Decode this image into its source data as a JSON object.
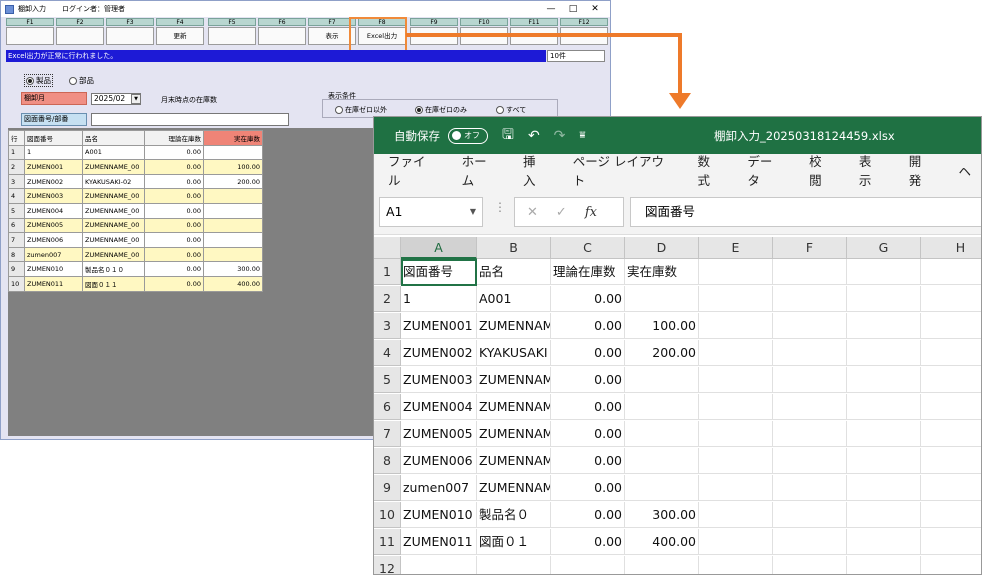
{
  "app": {
    "title": "棚卸入力",
    "login": "ログイン者：管理者",
    "window_controls": [
      "—",
      "□",
      "✕"
    ],
    "fkeys": [
      {
        "key": "F1",
        "label": ""
      },
      {
        "key": "F2",
        "label": ""
      },
      {
        "key": "F3",
        "label": ""
      },
      {
        "key": "F4",
        "label": "更新"
      },
      {
        "key": "F5",
        "label": ""
      },
      {
        "key": "F6",
        "label": ""
      },
      {
        "key": "F7",
        "label": "表示"
      },
      {
        "key": "F8",
        "label": "Excel出力"
      },
      {
        "key": "F9",
        "label": ""
      },
      {
        "key": "F10",
        "label": ""
      },
      {
        "key": "F11",
        "label": ""
      },
      {
        "key": "F12",
        "label": ""
      }
    ],
    "status_message": "Excel出力が正常に行われました。",
    "record_count": "10件",
    "type_options": [
      {
        "label": "製品",
        "selected": true
      },
      {
        "label": "部品",
        "selected": false
      }
    ],
    "tanaorosi_label": "棚卸月",
    "month_value": "2025/02",
    "month_note": "月末時点の在庫数",
    "zumen_label": "図面番号/部番",
    "zumen_value": "",
    "display_condition": {
      "title": "表示条件",
      "options": [
        {
          "label": "在庫ゼロ以外",
          "selected": false
        },
        {
          "label": "在庫ゼロのみ",
          "selected": true
        },
        {
          "label": "すべて",
          "selected": false
        }
      ]
    },
    "grid": {
      "headers": [
        "行",
        "図面番号",
        "品名",
        "理論在庫数",
        "実在庫数"
      ],
      "rows": [
        [
          "1",
          "1",
          "A001",
          "0.00",
          ""
        ],
        [
          "2",
          "ZUMEN001",
          "ZUMENNAME_00",
          "0.00",
          "100.00"
        ],
        [
          "3",
          "ZUMEN002",
          "KYAKUSAKI-02",
          "0.00",
          "200.00"
        ],
        [
          "4",
          "ZUMEN003",
          "ZUMENNAME_00",
          "0.00",
          ""
        ],
        [
          "5",
          "ZUMEN004",
          "ZUMENNAME_00",
          "0.00",
          ""
        ],
        [
          "6",
          "ZUMEN005",
          "ZUMENNAME_00",
          "0.00",
          ""
        ],
        [
          "7",
          "ZUMEN006",
          "ZUMENNAME_00",
          "0.00",
          ""
        ],
        [
          "8",
          "zumen007",
          "ZUMENNAME_00",
          "0.00",
          ""
        ],
        [
          "9",
          "ZUMEN010",
          "製品名０１０",
          "0.00",
          "300.00"
        ],
        [
          "10",
          "ZUMEN011",
          "図面０１１",
          "0.00",
          "400.00"
        ]
      ]
    }
  },
  "excel": {
    "autosave_label": "自動保存",
    "autosave_state": "オフ",
    "filename": "棚卸入力_20250318124459.xlsx",
    "ribbon_tabs": [
      "ファイル",
      "ホーム",
      "挿入",
      "ページ レイアウト",
      "数式",
      "データ",
      "校閲",
      "表示",
      "開発",
      "ヘ"
    ],
    "name_box": "A1",
    "formula": "図面番号",
    "columns": [
      "A",
      "B",
      "C",
      "D",
      "E",
      "F",
      "G",
      "H"
    ],
    "rows": [
      [
        "図面番号",
        "品名",
        "理論在庫数",
        "実在庫数"
      ],
      [
        "1",
        "A001",
        "0.00",
        ""
      ],
      [
        "ZUMEN001",
        "ZUMENNAME",
        "0.00",
        "100.00"
      ],
      [
        "ZUMEN002",
        "KYAKUSAKI",
        "0.00",
        "200.00"
      ],
      [
        "ZUMEN003",
        "ZUMENNAME",
        "0.00",
        ""
      ],
      [
        "ZUMEN004",
        "ZUMENNAME",
        "0.00",
        ""
      ],
      [
        "ZUMEN005",
        "ZUMENNAME",
        "0.00",
        ""
      ],
      [
        "ZUMEN006",
        "ZUMENNAME",
        "0.00",
        ""
      ],
      [
        "zumen007",
        "ZUMENNAME",
        "0.00",
        ""
      ],
      [
        "ZUMEN010",
        "製品名０",
        "0.00",
        "300.00"
      ],
      [
        "ZUMEN011",
        "図面０１",
        "0.00",
        "400.00"
      ],
      [
        "",
        "",
        "",
        ""
      ]
    ]
  },
  "colors": {
    "status_bar": "#1d1ad6",
    "excel_green": "#1f7143",
    "arrow": "#ee7a2a",
    "highlight": "#f08a3a"
  }
}
